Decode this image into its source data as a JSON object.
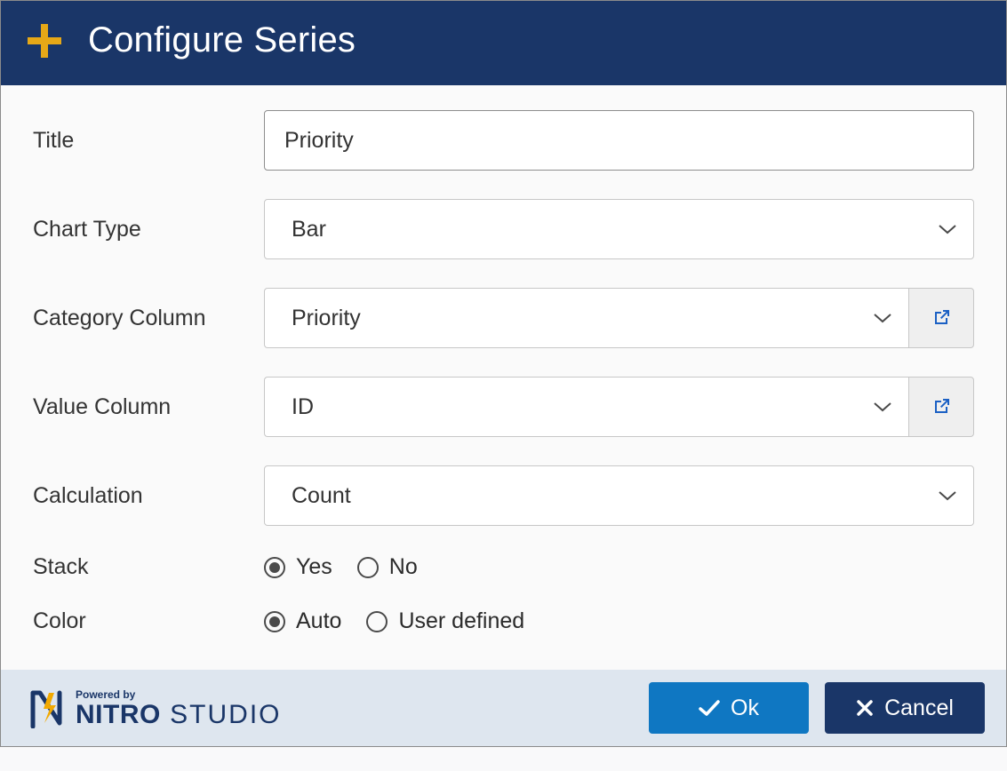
{
  "header": {
    "title": "Configure Series"
  },
  "form": {
    "title_label": "Title",
    "title_value": "Priority",
    "chart_type_label": "Chart Type",
    "chart_type_value": "Bar",
    "category_column_label": "Category Column",
    "category_column_value": "Priority",
    "value_column_label": "Value Column",
    "value_column_value": "ID",
    "calculation_label": "Calculation",
    "calculation_value": "Count",
    "stack_label": "Stack",
    "stack_options": {
      "yes": "Yes",
      "no": "No"
    },
    "stack_selected": "yes",
    "color_label": "Color",
    "color_options": {
      "auto": "Auto",
      "user": "User defined"
    },
    "color_selected": "auto"
  },
  "footer": {
    "powered_by": "Powered by",
    "brand_strong": "NITRO",
    "brand_light": " STUDIO",
    "ok_label": "Ok",
    "cancel_label": "Cancel"
  }
}
